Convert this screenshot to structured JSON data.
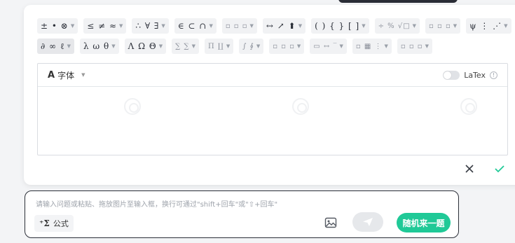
{
  "toolbar": {
    "row1": [
      {
        "glyphs": "± • ⊗"
      },
      {
        "glyphs": "≤ ≠ ≈"
      },
      {
        "glyphs": "∴ ∀ ∃"
      },
      {
        "glyphs": "∈ ⊂ ∩"
      },
      {
        "glyphs": "▫ ▫ ▫",
        "light": true
      },
      {
        "glyphs": "↔ ↗ ⬆"
      },
      {
        "glyphs": "( ) { } [ ]"
      },
      {
        "glyphs": "÷ % √□",
        "light": true
      },
      {
        "glyphs": "▫ ▫ ▫",
        "light": true
      },
      {
        "glyphs": "ψ ⋮ ⋰"
      }
    ],
    "row2": [
      {
        "glyphs": "∂ ∞ ℓ"
      },
      {
        "glyphs": "λ ω θ"
      },
      {
        "glyphs": "Λ Ω Θ"
      },
      {
        "glyphs": "∑ ∑",
        "light": true
      },
      {
        "glyphs": "Π ∐",
        "light": true
      },
      {
        "glyphs": "∫ ∮",
        "light": true
      },
      {
        "glyphs": "▫ ▫ ▫",
        "light": true
      },
      {
        "glyphs": "▭ ↔ ‾",
        "light": true
      },
      {
        "glyphs": "▫ ▦ ⋮",
        "light": true
      },
      {
        "glyphs": "▫ ▫ ▫",
        "light": true
      }
    ]
  },
  "formula": {
    "font_icon": "A",
    "font_label": "字体",
    "latex_label": "LaTex",
    "latex_enabled": false
  },
  "chat": {
    "placeholder": "请输入问题或粘贴、拖放图片至输入框，换行可通过\"shift+回车\"或\"⇧+回车\"",
    "formula_button": "公式",
    "formula_icon": "⁺Σ",
    "random_button": "随机来一题"
  },
  "colors": {
    "accent": "#20c997",
    "border_dark": "#2b2f38"
  }
}
